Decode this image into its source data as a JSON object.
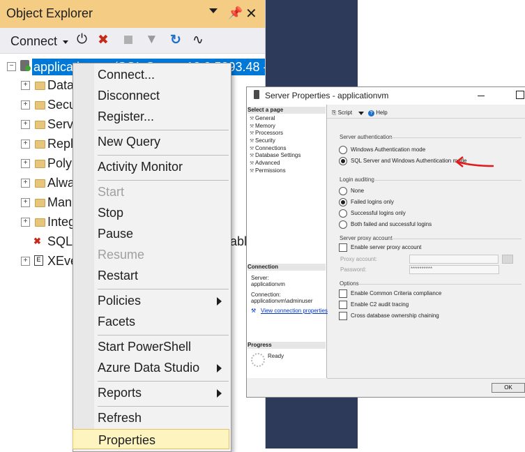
{
  "object_explorer": {
    "title": "Object Explorer",
    "toolbar": {
      "connect_label": "Connect"
    },
    "tree": {
      "server": "applicationvm (SQL Server 13.0.5893.48 -",
      "nodes": [
        "Data",
        "Secu",
        "Serv",
        "Repl",
        "Poly",
        "Alwa",
        "Man",
        "Integ",
        "SQL",
        "XEve"
      ],
      "sql_suffix": "able"
    }
  },
  "context_menu": {
    "items": [
      {
        "label": "Connect...",
        "disabled": false
      },
      {
        "label": "Disconnect",
        "disabled": false
      },
      {
        "label": "Register...",
        "disabled": false
      },
      {
        "label": "New Query",
        "disabled": false
      },
      {
        "label": "Activity Monitor",
        "disabled": false
      },
      {
        "label": "Start",
        "disabled": true
      },
      {
        "label": "Stop",
        "disabled": false
      },
      {
        "label": "Pause",
        "disabled": false
      },
      {
        "label": "Resume",
        "disabled": true
      },
      {
        "label": "Restart",
        "disabled": false
      },
      {
        "label": "Policies",
        "disabled": false
      },
      {
        "label": "Facets",
        "disabled": false
      },
      {
        "label": "Start PowerShell",
        "disabled": false
      },
      {
        "label": "Azure Data Studio",
        "disabled": false
      },
      {
        "label": "Reports",
        "disabled": false
      },
      {
        "label": "Refresh",
        "disabled": false
      },
      {
        "label": "Properties",
        "disabled": false,
        "selected": true
      }
    ]
  },
  "server_properties": {
    "title": "Server Properties - applicationvm",
    "select_page": "Select a page",
    "pages": [
      "General",
      "Memory",
      "Processors",
      "Security",
      "Connections",
      "Database Settings",
      "Advanced",
      "Permissions"
    ],
    "toolbar": {
      "script": "Script",
      "help": "Help"
    },
    "connection": {
      "header": "Connection",
      "server_label": "Server:",
      "server_value": "applicationvm",
      "connection_label": "Connection:",
      "connection_value": "applicationvm\\adminuser",
      "view_link": "View connection properties"
    },
    "progress": {
      "header": "Progress",
      "status": "Ready"
    },
    "server_authentication": {
      "label": "Server authentication",
      "windows": "Windows Authentication mode",
      "mixed": "SQL Server and Windows Authentication mode",
      "selected": "mixed"
    },
    "login_auditing": {
      "label": "Login auditing",
      "options": [
        "None",
        "Failed logins only",
        "Successful logins only",
        "Both failed and successful logins"
      ],
      "selected": "Failed logins only"
    },
    "proxy": {
      "label": "Server proxy account",
      "enable": "Enable server proxy account",
      "proxy_account_label": "Proxy account:",
      "password_label": "Password:",
      "password_value": "**********"
    },
    "options": {
      "label": "Options",
      "items": [
        "Enable Common Criteria compliance",
        "Enable C2 audit tracing",
        "Cross database ownership chaining"
      ]
    },
    "ok_label": "OK"
  },
  "colors": {
    "title_accent": "#f5cc84",
    "menu_selected": "#fdf4bf",
    "annotation": "#e01b1b"
  }
}
